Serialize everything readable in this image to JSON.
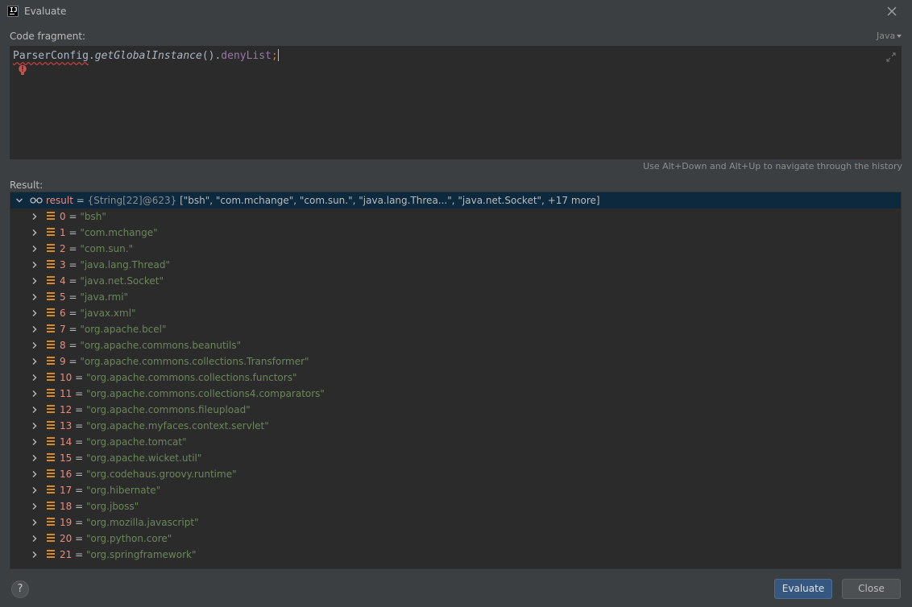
{
  "window": {
    "title": "Evaluate"
  },
  "editor": {
    "label": "Code fragment:",
    "language": "Java",
    "code": {
      "class_name": "ParserConfig",
      "dot1": ".",
      "method": "getGlobalInstance",
      "parens": "()",
      "dot2": ".",
      "field": "denyList",
      "semicolon": ";"
    },
    "history_hint": "Use Alt+Down and Alt+Up to navigate through the history"
  },
  "result": {
    "label": "Result:",
    "root": {
      "name": "result",
      "eq": " = ",
      "type": "{String[22]@623} ",
      "summary": "[\"bsh\", \"com.mchange\", \"com.sun.\", \"java.lang.Threa...\", \"java.net.Socket\", +17 more]"
    },
    "items": [
      {
        "index": "0",
        "value": "\"bsh\""
      },
      {
        "index": "1",
        "value": "\"com.mchange\""
      },
      {
        "index": "2",
        "value": "\"com.sun.\""
      },
      {
        "index": "3",
        "value": "\"java.lang.Thread\""
      },
      {
        "index": "4",
        "value": "\"java.net.Socket\""
      },
      {
        "index": "5",
        "value": "\"java.rmi\""
      },
      {
        "index": "6",
        "value": "\"javax.xml\""
      },
      {
        "index": "7",
        "value": "\"org.apache.bcel\""
      },
      {
        "index": "8",
        "value": "\"org.apache.commons.beanutils\""
      },
      {
        "index": "9",
        "value": "\"org.apache.commons.collections.Transformer\""
      },
      {
        "index": "10",
        "value": "\"org.apache.commons.collections.functors\""
      },
      {
        "index": "11",
        "value": "\"org.apache.commons.collections4.comparators\""
      },
      {
        "index": "12",
        "value": "\"org.apache.commons.fileupload\""
      },
      {
        "index": "13",
        "value": "\"org.apache.myfaces.context.servlet\""
      },
      {
        "index": "14",
        "value": "\"org.apache.tomcat\""
      },
      {
        "index": "15",
        "value": "\"org.apache.wicket.util\""
      },
      {
        "index": "16",
        "value": "\"org.codehaus.groovy.runtime\""
      },
      {
        "index": "17",
        "value": "\"org.hibernate\""
      },
      {
        "index": "18",
        "value": "\"org.jboss\""
      },
      {
        "index": "19",
        "value": "\"org.mozilla.javascript\""
      },
      {
        "index": "20",
        "value": "\"org.python.core\""
      },
      {
        "index": "21",
        "value": "\"org.springframework\""
      }
    ]
  },
  "footer": {
    "help_label": "?",
    "evaluate_label": "Evaluate",
    "close_label": "Close"
  }
}
